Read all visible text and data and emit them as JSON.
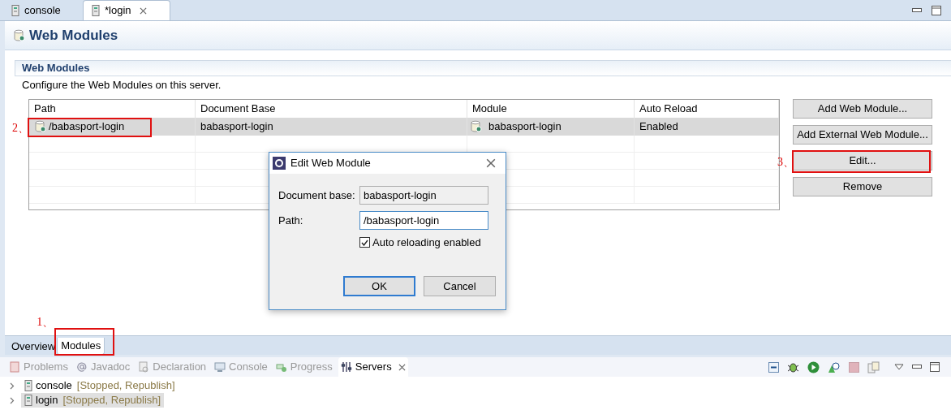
{
  "editor_tabs": [
    {
      "label": "console",
      "selected": false
    },
    {
      "label": "*login",
      "selected": true
    }
  ],
  "page_title": "Web Modules",
  "section": {
    "title": "Web Modules",
    "description": "Configure the Web Modules on this server."
  },
  "table": {
    "columns": [
      "Path",
      "Document Base",
      "Module",
      "Auto Reload"
    ],
    "rows": [
      {
        "path": "/babasport-login",
        "path_annotation": "2、",
        "document_base": "babasport-login",
        "module": "babasport-login",
        "auto_reload": "Enabled",
        "selected": true
      }
    ]
  },
  "buttons": [
    {
      "label": "Add Web Module..."
    },
    {
      "label": "Add External Web Module..."
    },
    {
      "label": "Edit...",
      "annotation": "3、"
    },
    {
      "label": "Remove"
    }
  ],
  "dialog": {
    "title": "Edit Web Module",
    "fields": [
      {
        "label": "Document base:",
        "value": "babasport-login",
        "disabled": true
      },
      {
        "label": "Path:",
        "value": "/babasport-login",
        "disabled": false
      }
    ],
    "checkbox": {
      "label": "Auto reloading enabled",
      "checked": true
    },
    "buttons": [
      {
        "label": "OK",
        "default": true
      },
      {
        "label": "Cancel",
        "default": false
      }
    ]
  },
  "page_tabs": [
    {
      "label": "Overview",
      "selected": false
    },
    {
      "label": "Modules",
      "selected": true,
      "annotation": "1、"
    }
  ],
  "views": {
    "tabs": [
      {
        "label": "Problems",
        "selected": false,
        "kind": "problems"
      },
      {
        "label": "Javadoc",
        "selected": false,
        "kind": "javadoc"
      },
      {
        "label": "Declaration",
        "selected": false,
        "kind": "declaration"
      },
      {
        "label": "Console",
        "selected": false,
        "kind": "console"
      },
      {
        "label": "Progress",
        "selected": false,
        "kind": "progress"
      },
      {
        "label": "Servers",
        "selected": true,
        "kind": "servers"
      }
    ],
    "servers": [
      {
        "name": "console",
        "status": "[Stopped, Republish]",
        "selected": false
      },
      {
        "name": "login",
        "status": "[Stopped, Republish]",
        "selected": true
      }
    ]
  }
}
